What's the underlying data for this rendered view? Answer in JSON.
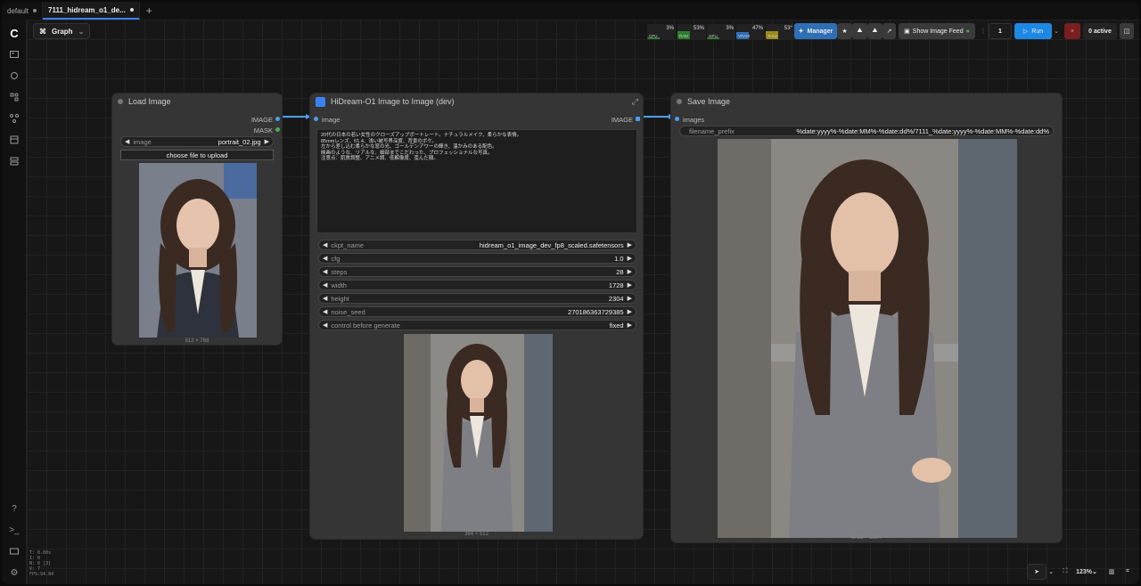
{
  "tabs": [
    {
      "label": "default"
    },
    {
      "label": "7111_hidream_o1_de..."
    }
  ],
  "toolbar": {
    "graph_label": "Graph",
    "resources": [
      {
        "label": "CPU",
        "pct": "3%",
        "color": "#2f7d32"
      },
      {
        "label": "RAM",
        "pct": "53%",
        "color": "#2f7d32"
      },
      {
        "label": "GPU",
        "pct": "3%",
        "color": "#2f7d32"
      },
      {
        "label": "VRAM",
        "pct": "47%",
        "color": "#2f6fb6"
      },
      {
        "label": "Temp",
        "pct": "53°",
        "color": "#9c8a1a"
      }
    ],
    "manager_label": "Manager",
    "image_feed_label": "Show Image Feed",
    "batch_count": "1",
    "run_label": "Run",
    "queue_label": "0 active"
  },
  "sidebar_stats": [
    "T: 0.00s",
    "I: 0",
    "N: 0 [3]",
    "V: 7",
    "FPS:94.84"
  ],
  "nodes": {
    "load_image": {
      "title": "Load Image",
      "out_image": "IMAGE",
      "out_mask": "MASK",
      "image_widget_label": "image",
      "image_widget_value": "portrait_02.jpg",
      "upload_label": "choose file to upload",
      "size_caption": "512 × 768"
    },
    "hidream": {
      "title": "HiDream-O1 Image to Image (dev)",
      "in_image": "image",
      "out_image": "IMAGE",
      "prompt": "20代の日本の若い女性のクローズアップポートレート。ナチュラルメイク、柔らかな表情。\n85mmレンズ、f/1.4、浅い被写界深度、背景のボケ。\n左から差し込む柔らかな窓の光、ゴールデンアワーの輝き、温かみのある配色。\n映画のような、リアルな、細部までこだわった、プロフェッショナルな写真。\n注意点：肌質調整、アニメ調、低解像度、歪んだ顔。",
      "widgets": [
        {
          "label": "ckpt_name",
          "value": "hidream_o1_image_dev_fp8_scaled.safetensors"
        },
        {
          "label": "cfg",
          "value": "1.0"
        },
        {
          "label": "steps",
          "value": "28"
        },
        {
          "label": "width",
          "value": "1728"
        },
        {
          "label": "height",
          "value": "2304"
        },
        {
          "label": "noise_seed",
          "value": "270186363729385"
        },
        {
          "label": "control before generate",
          "value": "fixed"
        }
      ],
      "size_caption": "384 × 512"
    },
    "save_image": {
      "title": "Save Image",
      "in_images": "images",
      "prefix_label": "filename_prefix",
      "prefix_value": "%date:yyyy%-%date:MM%-%date:dd%/7111_%date:yyyy%-%date:MM%-%date:dd%",
      "size_caption": "1728 × 2304"
    }
  },
  "zoom": {
    "level": "123%"
  },
  "colors": {
    "accent": "#3b82f6",
    "link": "#4a9eed",
    "mask": "#4caf50"
  }
}
